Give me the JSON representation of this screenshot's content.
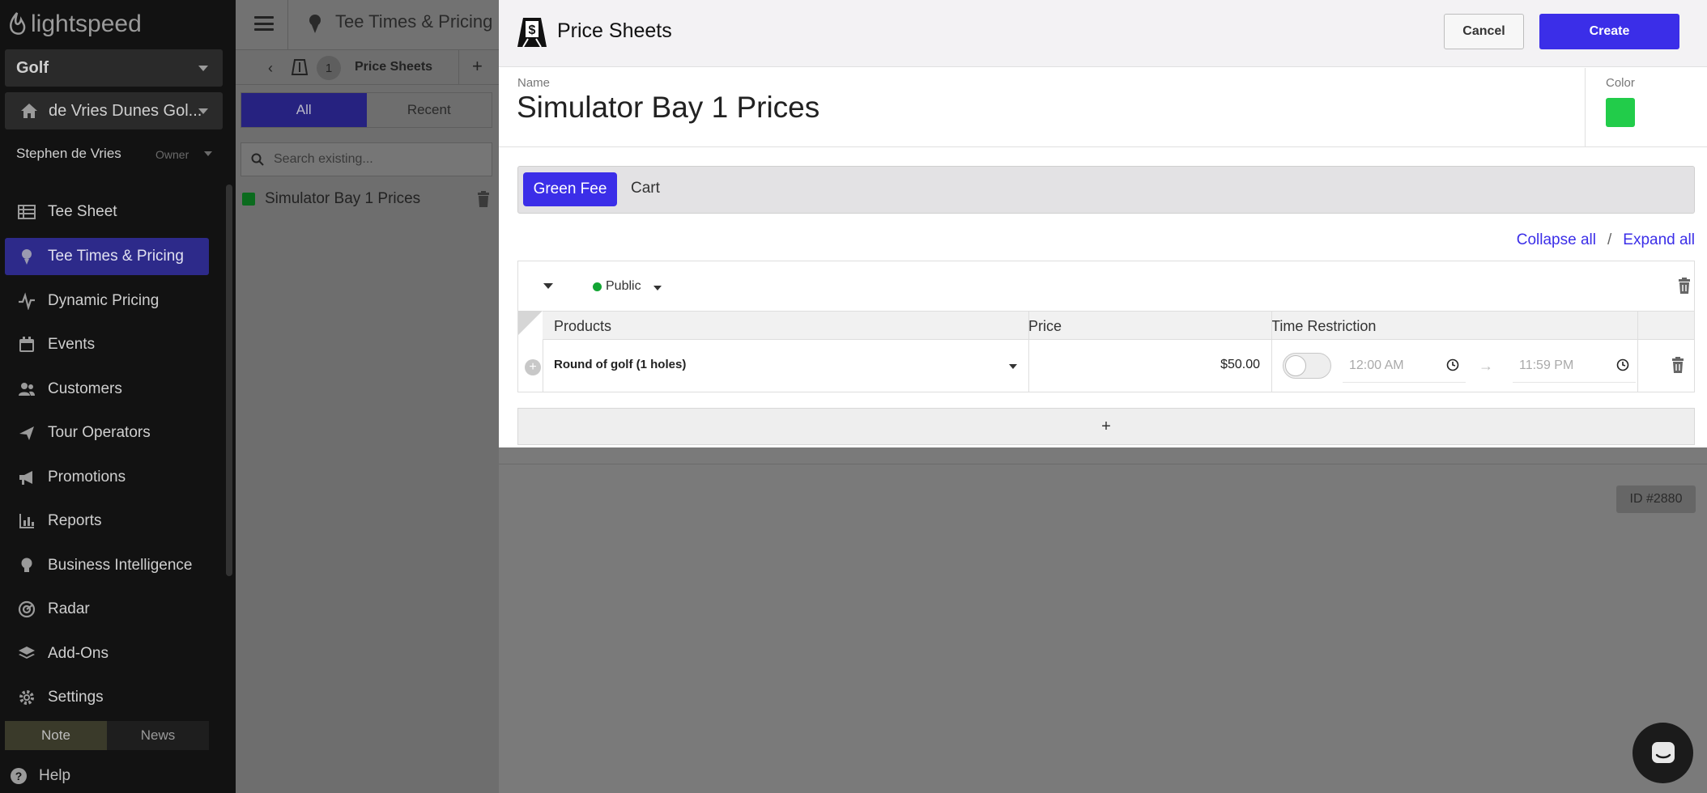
{
  "nav": {
    "logo_text": "lightspeed",
    "org_select": "Golf",
    "course_select": "de Vries Dunes Gol...",
    "user_name": "Stephen de Vries",
    "user_role": "Owner",
    "items": [
      {
        "label": "Tee Sheet",
        "icon": "table-icon"
      },
      {
        "label": "Tee Times & Pricing",
        "icon": "golf-pin-icon"
      },
      {
        "label": "Dynamic Pricing",
        "icon": "pulse-icon"
      },
      {
        "label": "Events",
        "icon": "calendar-icon"
      },
      {
        "label": "Customers",
        "icon": "users-icon"
      },
      {
        "label": "Tour Operators",
        "icon": "plane-icon"
      },
      {
        "label": "Promotions",
        "icon": "megaphone-icon"
      },
      {
        "label": "Reports",
        "icon": "bar-chart-icon"
      },
      {
        "label": "Business Intelligence",
        "icon": "bulb-icon"
      },
      {
        "label": "Radar",
        "icon": "radar-icon"
      },
      {
        "label": "Add-Ons",
        "icon": "layers-icon"
      },
      {
        "label": "Settings",
        "icon": "gear-icon"
      }
    ],
    "tab_note": "Note",
    "tab_news": "News",
    "help": "Help"
  },
  "panel": {
    "title": "Tee Times & Pricing",
    "sub_count": "1",
    "sub_title": "Price Sheets",
    "tab_all": "All",
    "tab_recent": "Recent",
    "search_placeholder": "Search existing...",
    "list": [
      {
        "label": "Simulator Bay 1 Prices",
        "color": "#0b6b1e"
      }
    ]
  },
  "dialog": {
    "title": "Price Sheets",
    "cancel": "Cancel",
    "create": "Create",
    "name_label": "Name",
    "name_value": "Simulator Bay 1 Prices",
    "color_label": "Color",
    "color_value": "#22cc4a",
    "tabs": [
      "Green Fee",
      "Cart"
    ],
    "collapse_all": "Collapse all",
    "separator": "/",
    "expand_all": "Expand all",
    "group": {
      "audience": "Public",
      "columns": [
        "Products",
        "Price",
        "Time Restriction"
      ],
      "rows": [
        {
          "product": "Round of golf (1 holes)",
          "price": "$50.00",
          "time_from": "12:00 AM",
          "time_to": "11:59 PM",
          "restricted": false
        }
      ]
    },
    "add_label": "+"
  },
  "footer": {
    "id_badge": "ID #2880"
  },
  "colors": {
    "accent": "#3b2ee8",
    "nav_active": "#2d2a8a",
    "status_public": "#13a534"
  }
}
